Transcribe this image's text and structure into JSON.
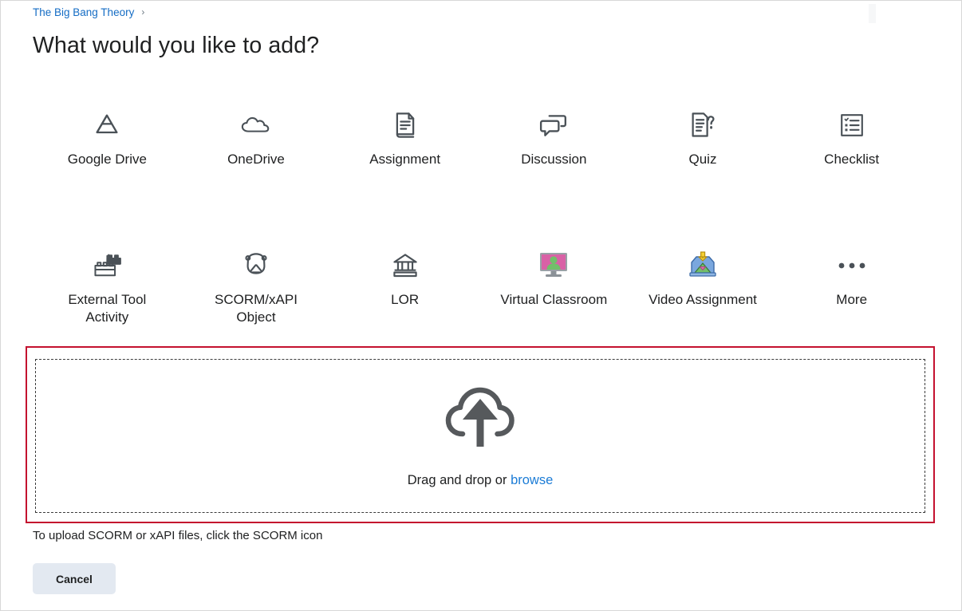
{
  "breadcrumb": {
    "course_link": "The Big Bang Theory",
    "separator": "›"
  },
  "page_title": "What would you like to add?",
  "tools": {
    "row1": [
      {
        "label": "Google Drive",
        "icon": "google-drive-icon"
      },
      {
        "label": "OneDrive",
        "icon": "onedrive-cloud-icon"
      },
      {
        "label": "Assignment",
        "icon": "assignment-document-icon"
      },
      {
        "label": "Discussion",
        "icon": "discussion-bubbles-icon"
      },
      {
        "label": "Quiz",
        "icon": "quiz-question-document-icon"
      },
      {
        "label": "Checklist",
        "icon": "checklist-icon"
      }
    ],
    "row2": [
      {
        "label": "External Tool Activity",
        "icon": "lego-bricks-icon"
      },
      {
        "label": "SCORM/xAPI Object",
        "icon": "scorm-xapi-icon"
      },
      {
        "label": "LOR",
        "icon": "repository-building-icon"
      },
      {
        "label": "Virtual Classroom",
        "icon": "virtual-classroom-monitor-icon"
      },
      {
        "label": "Video Assignment",
        "icon": "video-assignment-tray-icon"
      },
      {
        "label": "More",
        "icon": "more-ellipsis-icon"
      }
    ]
  },
  "dropzone": {
    "icon": "cloud-upload-icon",
    "prompt_prefix": "Drag and drop or ",
    "browse_label": "browse"
  },
  "scorm_note": "To upload SCORM or xAPI files, click the SCORM icon",
  "cancel_label": "Cancel",
  "colors": {
    "link_blue": "#146cc4",
    "browse_blue": "#1c7cd6",
    "dropzone_red": "#c4112f",
    "icon_gray": "#4a5157",
    "button_bg": "#e3e9f1",
    "text": "#202122",
    "classroom_pink": "#d961a6",
    "classroom_green": "#72bf6a",
    "tray_blue": "#7aa7de",
    "arrow_yellow": "#f5d033"
  }
}
